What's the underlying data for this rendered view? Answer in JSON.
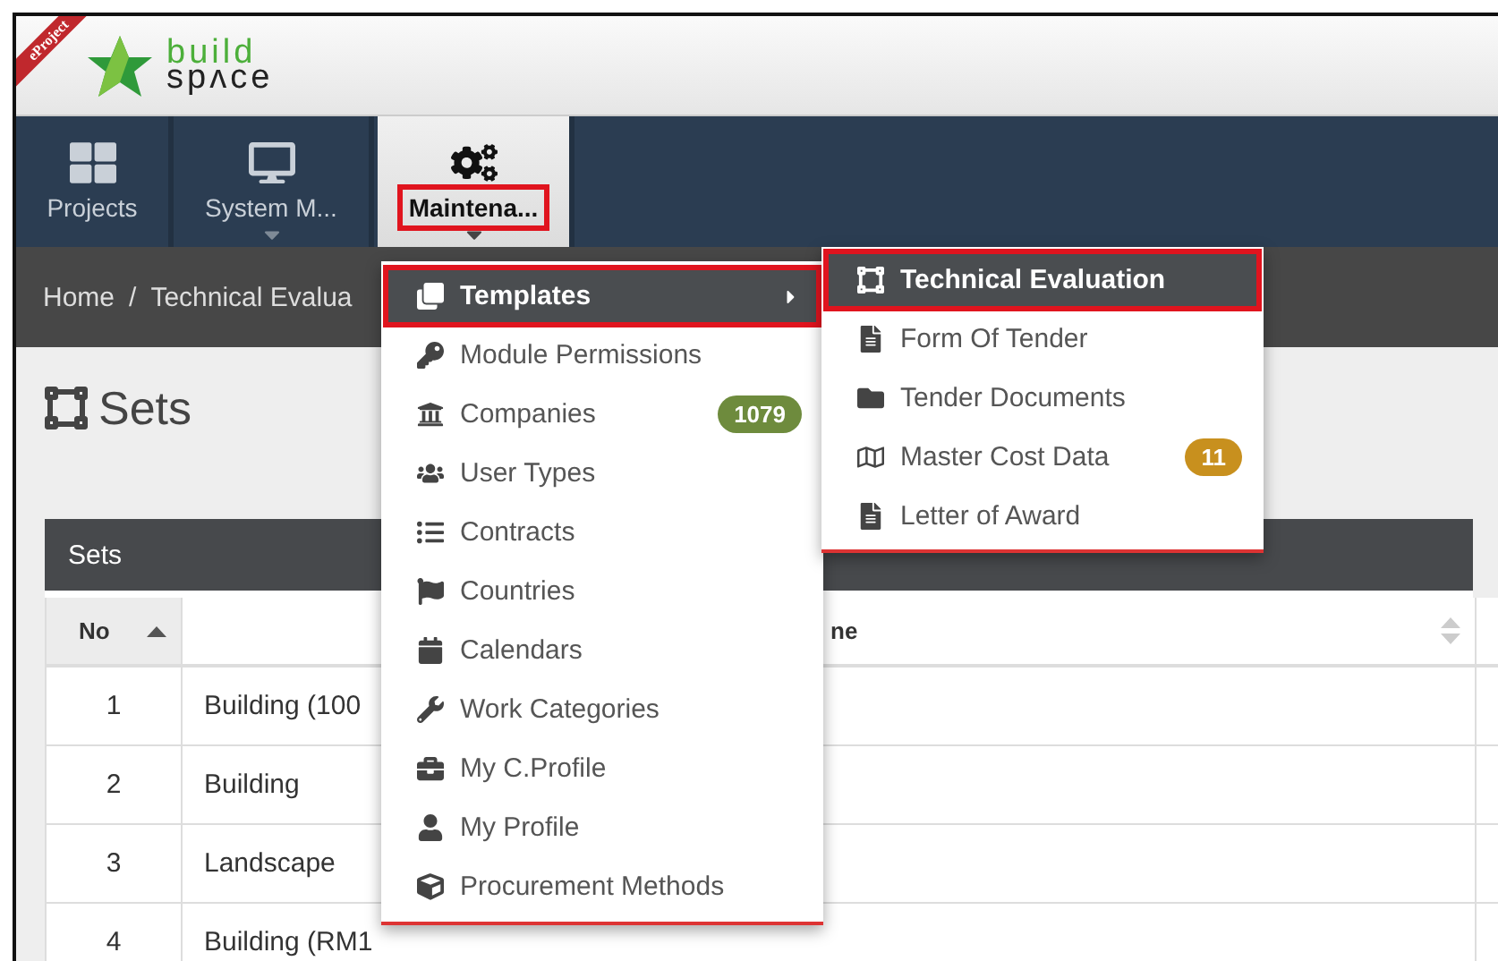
{
  "header": {
    "ribbon": "eProject",
    "logo_top": "build",
    "logo_bottom": "spʌce"
  },
  "nav": [
    {
      "label": "Projects",
      "selected": false,
      "caret": false,
      "highlighted": false
    },
    {
      "label": "System M...",
      "selected": false,
      "caret": true,
      "highlighted": false
    },
    {
      "label": "Maintena...",
      "selected": true,
      "caret": true,
      "highlighted": true
    }
  ],
  "breadcrumb": {
    "items": [
      "Home",
      "Technical Evalua"
    ],
    "separator": "/"
  },
  "page_title": "Sets",
  "panel": {
    "title": "Sets"
  },
  "table": {
    "columns": [
      {
        "label": "No",
        "sorted": true
      },
      {
        "label": "ne",
        "sorted": false
      }
    ],
    "rows": [
      {
        "no": "1",
        "name": "Building (100"
      },
      {
        "no": "2",
        "name": "Building"
      },
      {
        "no": "3",
        "name": "Landscape"
      },
      {
        "no": "4",
        "name": "Building (RM1"
      }
    ]
  },
  "menu": [
    {
      "label": "Templates",
      "selected": true,
      "highlighted": true,
      "submenu": true
    },
    {
      "label": "Module Permissions",
      "selected": false,
      "highlighted": false,
      "submenu": false
    },
    {
      "label": "Companies",
      "selected": false,
      "highlighted": false,
      "submenu": false,
      "badge": "1079",
      "color": "#6e8b3d"
    },
    {
      "label": "User Types",
      "selected": false,
      "highlighted": false,
      "submenu": false
    },
    {
      "label": "Contracts",
      "selected": false,
      "highlighted": false,
      "submenu": false
    },
    {
      "label": "Countries",
      "selected": false,
      "highlighted": false,
      "submenu": false
    },
    {
      "label": "Calendars",
      "selected": false,
      "highlighted": false,
      "submenu": false
    },
    {
      "label": "Work Categories",
      "selected": false,
      "highlighted": false,
      "submenu": false
    },
    {
      "label": "My C.Profile",
      "selected": false,
      "highlighted": false,
      "submenu": false
    },
    {
      "label": "My Profile",
      "selected": false,
      "highlighted": false,
      "submenu": false
    },
    {
      "label": "Procurement Methods",
      "selected": false,
      "highlighted": false,
      "submenu": false
    }
  ],
  "submenu": [
    {
      "label": "Technical Evaluation",
      "selected": true,
      "highlighted": true
    },
    {
      "label": "Form Of Tender",
      "selected": false,
      "highlighted": false
    },
    {
      "label": "Tender Documents",
      "selected": false,
      "highlighted": false
    },
    {
      "label": "Master Cost Data",
      "selected": false,
      "highlighted": false,
      "badge": "11",
      "color": "#c8901e"
    },
    {
      "label": "Letter of Award",
      "selected": false,
      "highlighted": false
    }
  ]
}
